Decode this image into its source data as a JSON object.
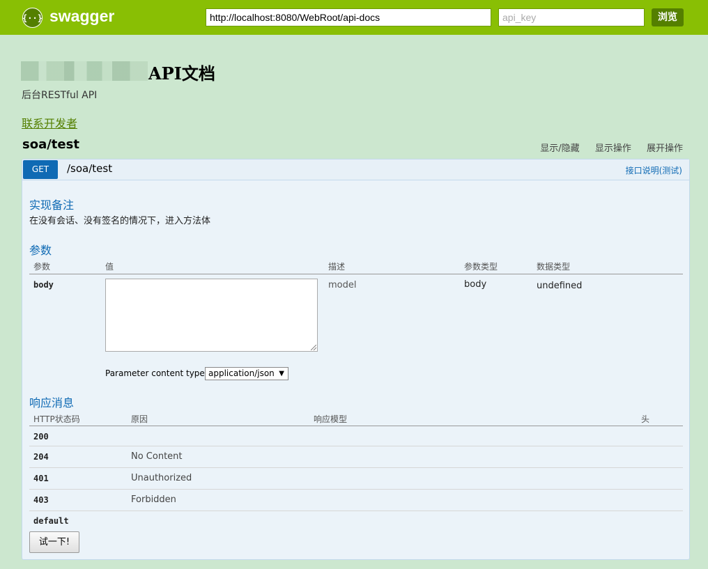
{
  "header": {
    "logo_text": "swagger",
    "url_value": "http://localhost:8080/WebRoot/api-docs",
    "api_key_placeholder": "api_key",
    "explore_label": "浏览"
  },
  "info": {
    "title": "API文档",
    "description": "后台RESTful API",
    "contact_link": "联系开发者"
  },
  "resource": {
    "name": "soa/test",
    "links": [
      "显示/隐藏",
      "显示操作",
      "展开操作"
    ]
  },
  "operation": {
    "method": "GET",
    "path": "/soa/test",
    "summary_link": "接口说明(测试)",
    "notes_heading": "实现备注",
    "notes_text": "在没有会话、没有签名的情况下，进入方法体",
    "params_heading": "参数",
    "params_columns": [
      "参数",
      "值",
      "描述",
      "参数类型",
      "数据类型"
    ],
    "params": [
      {
        "name": "body",
        "value": "",
        "description": "model",
        "param_type": "body",
        "data_type": "undefined"
      }
    ],
    "content_type_label": "Parameter content type:",
    "content_type_selected": "application/json",
    "responses_heading": "响应消息",
    "responses_columns": [
      "HTTP状态码",
      "原因",
      "响应模型",
      "头"
    ],
    "responses": [
      {
        "code": "200",
        "reason": ""
      },
      {
        "code": "204",
        "reason": "No Content"
      },
      {
        "code": "401",
        "reason": "Unauthorized"
      },
      {
        "code": "403",
        "reason": "Forbidden"
      },
      {
        "code": "default",
        "reason": ""
      }
    ],
    "try_button": "试一下!"
  },
  "colors": {
    "header_bg": "#89bf04",
    "page_bg": "#cce7cf",
    "get_badge": "#0f6ab4",
    "link_green": "#547f00"
  }
}
